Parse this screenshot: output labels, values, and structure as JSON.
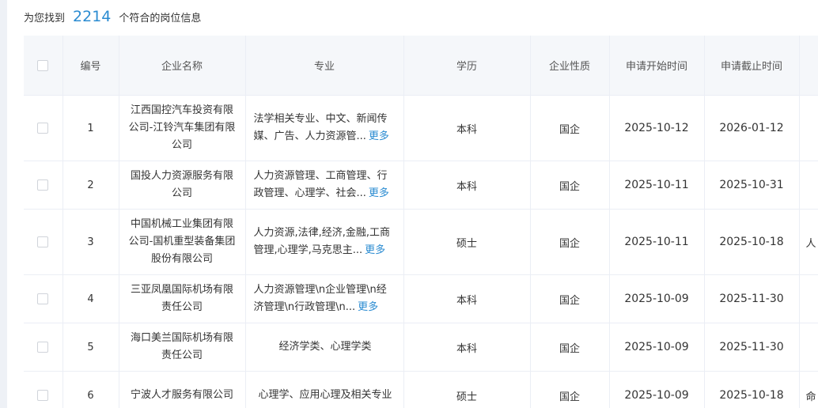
{
  "summary": {
    "prefix": "为您找到",
    "count": "2214",
    "suffix": "个符合的岗位信息"
  },
  "headers": {
    "id": "编号",
    "company": "企业名称",
    "major": "专业",
    "edu": "学历",
    "type": "企业性质",
    "start": "申请开始时间",
    "end": "申请截止时间"
  },
  "more_label": "更多",
  "rows": [
    {
      "id": "1",
      "company": "江西国控汽车投资有限公司-江铃汽车集团有限公司",
      "major": "法学相关专业、中文、新闻传媒、广告、人力资源管...",
      "edu": "本科",
      "type": "国企",
      "start": "2025-10-12",
      "end": "2026-01-12",
      "extra": ""
    },
    {
      "id": "2",
      "company": "国投人力资源服务有限公司",
      "major": "人力资源管理、工商管理、行政管理、心理学、社会...",
      "edu": "本科",
      "type": "国企",
      "start": "2025-10-11",
      "end": "2025-10-31",
      "extra": ""
    },
    {
      "id": "3",
      "company": "中国机械工业集团有限公司-国机重型装备集团股份有限公司",
      "major": "人力资源,法律,经济,金融,工商管理,心理学,马克思主...",
      "edu": "硕士",
      "type": "国企",
      "start": "2025-10-11",
      "end": "2025-10-18",
      "extra": "人"
    },
    {
      "id": "4",
      "company": "三亚凤凰国际机场有限责任公司",
      "major": "人力资源管理\\n企业管理\\n经济管理\\n行政管理\\n...",
      "edu": "本科",
      "type": "国企",
      "start": "2025-10-09",
      "end": "2025-11-30",
      "extra": ""
    },
    {
      "id": "5",
      "company": "海口美兰国际机场有限责任公司",
      "major": "经济学类、心理学类",
      "edu": "本科",
      "type": "国企",
      "start": "2025-10-09",
      "end": "2025-11-30",
      "extra": ""
    },
    {
      "id": "6",
      "company": "宁波人才服务有限公司",
      "major": "心理学、应用心理及相关专业",
      "edu": "硕士",
      "type": "国企",
      "start": "2025-10-09",
      "end": "2025-10-18",
      "extra": "命"
    }
  ]
}
